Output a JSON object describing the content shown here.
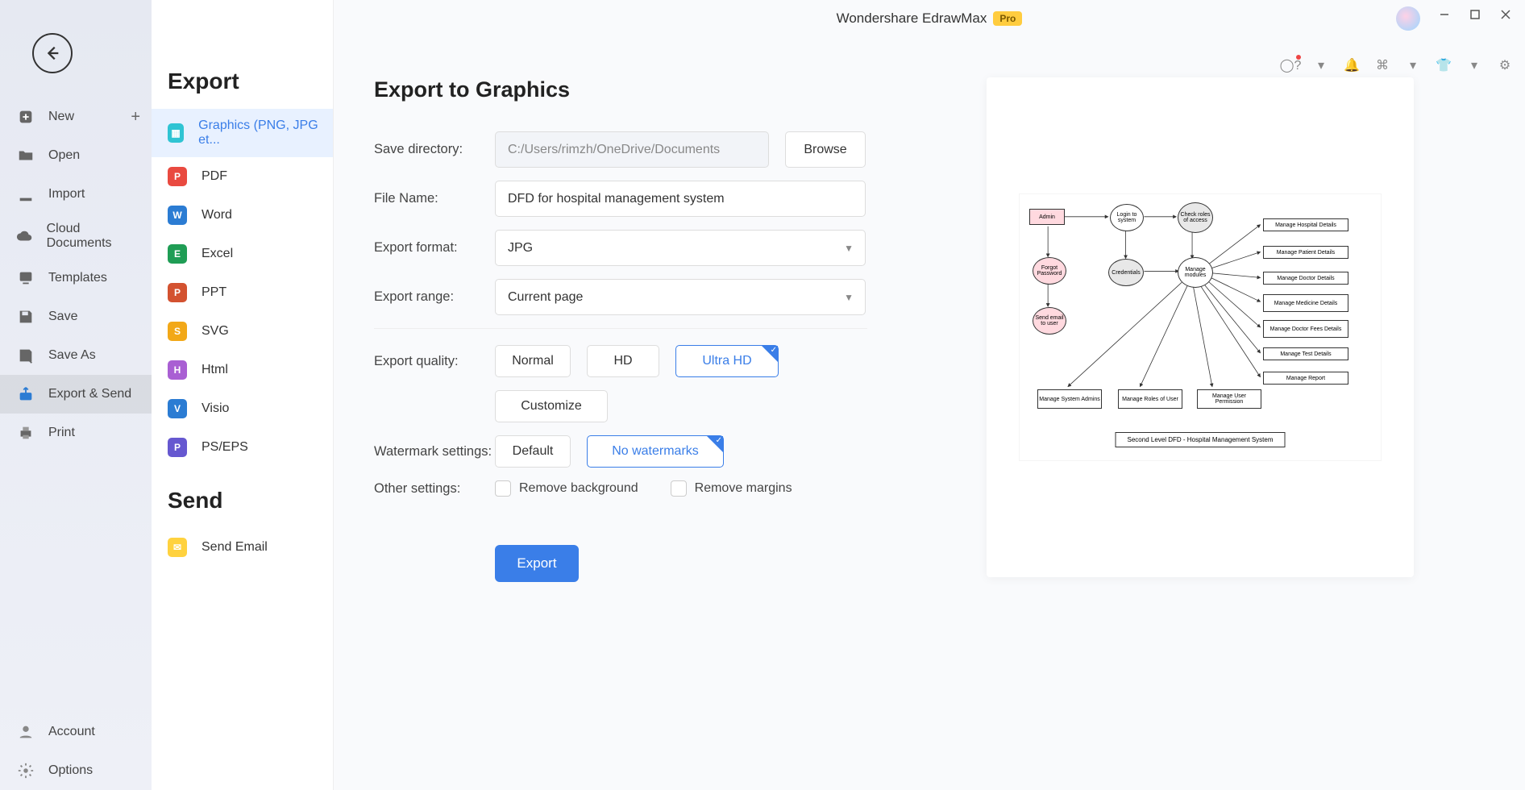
{
  "app": {
    "title": "Wondershare EdrawMax",
    "badge": "Pro"
  },
  "leftnav": {
    "items": [
      {
        "label": "New",
        "plus": true
      },
      {
        "label": "Open"
      },
      {
        "label": "Import"
      },
      {
        "label": "Cloud Documents"
      },
      {
        "label": "Templates"
      },
      {
        "label": "Save"
      },
      {
        "label": "Save As"
      },
      {
        "label": "Export & Send",
        "active": true
      },
      {
        "label": "Print"
      }
    ],
    "footer": [
      {
        "label": "Account"
      },
      {
        "label": "Options"
      }
    ]
  },
  "typenav": {
    "heading_export": "Export",
    "heading_send": "Send",
    "export_items": [
      {
        "label": "Graphics (PNG, JPG et...",
        "cls": "img",
        "active": true
      },
      {
        "label": "PDF",
        "cls": "pdf"
      },
      {
        "label": "Word",
        "cls": "word"
      },
      {
        "label": "Excel",
        "cls": "excel"
      },
      {
        "label": "PPT",
        "cls": "ppt"
      },
      {
        "label": "SVG",
        "cls": "svg"
      },
      {
        "label": "Html",
        "cls": "html"
      },
      {
        "label": "Visio",
        "cls": "visio"
      },
      {
        "label": "PS/EPS",
        "cls": "ps"
      }
    ],
    "send_items": [
      {
        "label": "Send Email",
        "cls": "mail"
      }
    ]
  },
  "form": {
    "title": "Export to Graphics",
    "save_dir_label": "Save directory:",
    "save_dir_value": "C:/Users/rimzh/OneDrive/Documents",
    "browse": "Browse",
    "file_name_label": "File Name:",
    "file_name_value": "DFD for hospital management system",
    "format_label": "Export format:",
    "format_value": "JPG",
    "range_label": "Export range:",
    "range_value": "Current page",
    "quality_label": "Export quality:",
    "quality_options": {
      "normal": "Normal",
      "hd": "HD",
      "uhd": "Ultra HD",
      "customize": "Customize"
    },
    "watermark_label": "Watermark settings:",
    "watermark_options": {
      "default": "Default",
      "none": "No watermarks"
    },
    "other_label": "Other settings:",
    "chk_bg": "Remove background",
    "chk_margins": "Remove margins",
    "export_btn": "Export"
  },
  "preview": {
    "caption": "Second Level DFD - Hospital Management System",
    "nodes": {
      "admin": "Admin",
      "login": "Login to system",
      "roles": "Check roles of access",
      "forgot": "Forgot Password",
      "cred": "Credentials",
      "modules": "Manage modules",
      "sendemail": "Send email to user",
      "r1": "Manage Hospital Details",
      "r2": "Manage Patient Details",
      "r3": "Manage Doctor Details",
      "r4": "Manage Medicine Details",
      "r5": "Manage Doctor Fees Details",
      "r6": "Manage Test Details",
      "r7": "Manage Report",
      "b1": "Manage System Admins",
      "b2": "Manage Roles of User",
      "b3": "Manage User Permission"
    }
  }
}
